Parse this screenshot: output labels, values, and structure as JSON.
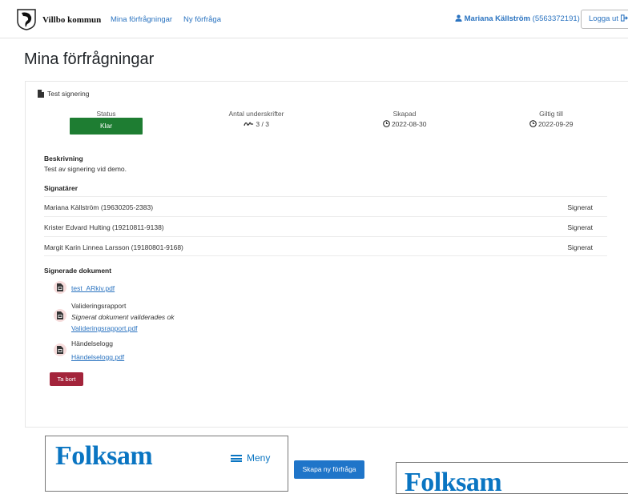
{
  "nav": {
    "brand": "Villbo kommun",
    "links": [
      "Mina förfrågningar",
      "Ny förfråga"
    ],
    "user_name": "Mariana Källström",
    "user_id": "(5563372191)",
    "logout_label": "Logga ut",
    "icons": [
      "municipal-logo",
      "user-icon",
      "sign-out-icon"
    ]
  },
  "page_title": "Mina förfrågningar",
  "request": {
    "title": "Test signering",
    "status_label": "Status",
    "status_value": "Klar",
    "signatures_label": "Antal underskrifter",
    "signatures_value": "3 / 3",
    "created_label": "Skapad",
    "created_value": "2022-08-30",
    "valid_label": "Giltig till",
    "valid_value": "2022-09-29",
    "description_heading": "Beskrivning",
    "description": "Test av signering vid demo.",
    "signers_heading": "Signatärer",
    "signers": [
      {
        "name": "Mariana Källström (19630205-2383)",
        "status": "Signerat"
      },
      {
        "name": "Krister Edvard Hulting (19210811-9138)",
        "status": "Signerat"
      },
      {
        "name": "Margit Karin Linnea Larsson (19180801-9168)",
        "status": "Signerat"
      }
    ],
    "docs_heading": "Signerade dokument",
    "documents": {
      "main_file": "test_ARkiv.pdf",
      "validation_label": "Valideringsrapport",
      "validation_note": "Signerat dokument validerades ok",
      "validation_file": "Valideringsrapport.pdf",
      "log_label": "Händelselogg",
      "log_file": "Händelselogg.pdf"
    },
    "delete_label": "Ta bort"
  },
  "ads": {
    "brand": "Folksam",
    "menu_label": "Meny",
    "brand_color": "#0a75c2"
  },
  "create_button_label": "Skapa ny förfråga",
  "colors": {
    "status_green": "#1e7d32",
    "delete_red": "#a3243b",
    "link_blue": "#2a73c0",
    "primary_blue": "#1f75c9"
  }
}
